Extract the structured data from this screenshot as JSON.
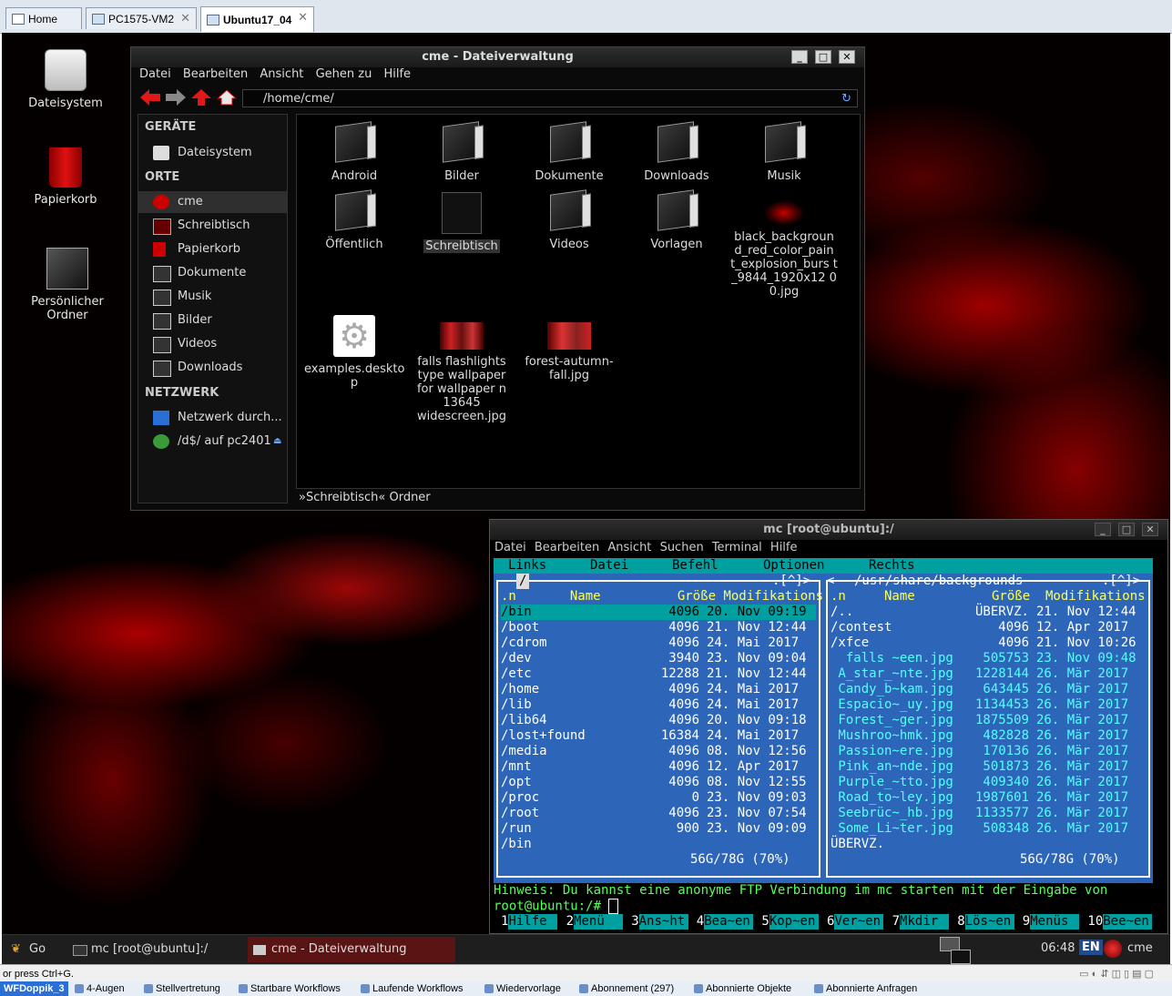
{
  "host_tabs": [
    {
      "label": "Home"
    },
    {
      "label": "PC1575-VM2"
    },
    {
      "label": "Ubuntu17_04"
    }
  ],
  "desktop_icons": [
    {
      "label": "Dateisystem"
    },
    {
      "label": "Papierkorb"
    },
    {
      "label": "Persönlicher Ordner"
    }
  ],
  "file_manager": {
    "title": "cme - Dateiverwaltung",
    "menu": [
      "Datei",
      "Bearbeiten",
      "Ansicht",
      "Gehen zu",
      "Hilfe"
    ],
    "path": "/home/cme/",
    "sidebar": {
      "devices_header": "GERÄTE",
      "devices": [
        "Dateisystem"
      ],
      "places_header": "ORTE",
      "places": [
        "cme",
        "Schreibtisch",
        "Papierkorb",
        "Dokumente",
        "Musik",
        "Bilder",
        "Videos",
        "Downloads"
      ],
      "network_header": "NETZWERK",
      "network": [
        "Netzwerk durch...",
        "/d$/ auf pc2401"
      ]
    },
    "items": [
      {
        "label": "Android"
      },
      {
        "label": "Bilder"
      },
      {
        "label": "Dokumente"
      },
      {
        "label": "Downloads"
      },
      {
        "label": "Musik"
      },
      {
        "label": "Öffentlich"
      },
      {
        "label": "Schreibtisch"
      },
      {
        "label": "Videos"
      },
      {
        "label": "Vorlagen"
      },
      {
        "label": "black_backgroun d_red_color_pain t_explosion_burs t_9844_1920x12 00.jpg"
      },
      {
        "label": "examples.deskto p"
      },
      {
        "label": "falls flashlights type wallpaper for wallpaper n 13645 widescreen.jpg"
      },
      {
        "label": "forest-autumn- fall.jpg"
      }
    ],
    "status": "»Schreibtisch« Ordner"
  },
  "terminal": {
    "title": "mc [root@ubuntu]:/",
    "menu": [
      "Datei",
      "Bearbeiten",
      "Ansicht",
      "Suchen",
      "Terminal",
      "Hilfe"
    ],
    "mc_top": [
      "Links",
      "Datei",
      "Befehl",
      "Optionen",
      "Rechts"
    ],
    "left_panel": {
      "path": "/",
      "header": ".n       Name          Größe Modifikations",
      "rows": [
        {
          "name": "/bin",
          "size": "4096",
          "date": "20. Nov 09:19"
        },
        {
          "name": "/boot",
          "size": "4096",
          "date": "21. Nov 12:44"
        },
        {
          "name": "/cdrom",
          "size": "4096",
          "date": "24. Mai 2017"
        },
        {
          "name": "/dev",
          "size": "3940",
          "date": "23. Nov 09:04"
        },
        {
          "name": "/etc",
          "size": "12288",
          "date": "21. Nov 12:44"
        },
        {
          "name": "/home",
          "size": "4096",
          "date": "24. Mai 2017"
        },
        {
          "name": "/lib",
          "size": "4096",
          "date": "24. Mai 2017"
        },
        {
          "name": "/lib64",
          "size": "4096",
          "date": "20. Nov 09:18"
        },
        {
          "name": "/lost+found",
          "size": "16384",
          "date": "24. Mai 2017"
        },
        {
          "name": "/media",
          "size": "4096",
          "date": "08. Nov 12:56"
        },
        {
          "name": "/mnt",
          "size": "4096",
          "date": "12. Apr 2017"
        },
        {
          "name": "/opt",
          "size": "4096",
          "date": "08. Nov 12:55"
        },
        {
          "name": "/proc",
          "size": "0",
          "date": "23. Nov 09:03"
        },
        {
          "name": "/root",
          "size": "4096",
          "date": "23. Nov 07:54"
        },
        {
          "name": "/run",
          "size": "900",
          "date": "23. Nov 09:09"
        }
      ],
      "mini_status": "/bin",
      "disk": "56G/78G (70%)"
    },
    "right_panel": {
      "path": "/usr/share/backgrounds",
      "header": ".n     Name          Größe  Modifikations",
      "rows": [
        {
          "name": "/..",
          "size": "ÜBERVZ.",
          "date": "21. Nov 12:44"
        },
        {
          "name": "/contest",
          "size": "4096",
          "date": "12. Apr 2017"
        },
        {
          "name": "/xfce",
          "size": "4096",
          "date": "21. Nov 10:26"
        },
        {
          "name": "  falls ~een.jpg",
          "size": "505753",
          "date": "23. Nov 09:48"
        },
        {
          "name": " A_star_~nte.jpg",
          "size": "1228144",
          "date": "26. Mär 2017"
        },
        {
          "name": " Candy_b~kam.jpg",
          "size": "643445",
          "date": "26. Mär 2017"
        },
        {
          "name": " Espacio~_uy.jpg",
          "size": "1134453",
          "date": "26. Mär 2017"
        },
        {
          "name": " Forest_~ger.jpg",
          "size": "1875509",
          "date": "26. Mär 2017"
        },
        {
          "name": " Mushroo~hmk.jpg",
          "size": "482828",
          "date": "26. Mär 2017"
        },
        {
          "name": " Passion~ere.jpg",
          "size": "170136",
          "date": "26. Mär 2017"
        },
        {
          "name": " Pink_an~nde.jpg",
          "size": "501873",
          "date": "26. Mär 2017"
        },
        {
          "name": " Purple_~tto.jpg",
          "size": "409340",
          "date": "26. Mär 2017"
        },
        {
          "name": " Road_to~ley.jpg",
          "size": "1987601",
          "date": "26. Mär 2017"
        },
        {
          "name": " Seebrüc~_hb.jpg",
          "size": "1133577",
          "date": "26. Mär 2017"
        },
        {
          "name": " Some_Li~ter.jpg",
          "size": "508348",
          "date": "26. Mär 2017"
        }
      ],
      "mini_status": "ÜBERVZ.",
      "disk": "56G/78G (70%)"
    },
    "hint": "Hinweis: Du kannst eine anonyme FTP Verbindung im mc starten mit der Eingabe von",
    "prompt": "root@ubuntu:/# ",
    "fkeys": [
      {
        "n": "1",
        "l": "Hilfe"
      },
      {
        "n": "2",
        "l": "Menü"
      },
      {
        "n": "3",
        "l": "Ans~ht"
      },
      {
        "n": "4",
        "l": "Bea~en"
      },
      {
        "n": "5",
        "l": "Kop~en"
      },
      {
        "n": "6",
        "l": "Ver~en"
      },
      {
        "n": "7",
        "l": "Mkdir"
      },
      {
        "n": "8",
        "l": "Lös~en"
      },
      {
        "n": "9",
        "l": "Menüs"
      },
      {
        "n": "10",
        "l": "Bee~en"
      }
    ]
  },
  "taskbar": {
    "go": "Go",
    "task1": "mc [root@ubuntu]:/",
    "task2": "cme - Dateiverwaltung",
    "clock": "06:48",
    "lang": "EN",
    "user": "cme"
  },
  "host_status": "or press Ctrl+G.",
  "host_bar": [
    "WFDoppik_3",
    "4-Augen",
    "Stellvertretung",
    "Startbare Workflows",
    "Laufende Workflows",
    "Wiedervorlage",
    "Abonnement (297)",
    "Abonnierte Objekte",
    "Abonnierte Anfragen"
  ]
}
